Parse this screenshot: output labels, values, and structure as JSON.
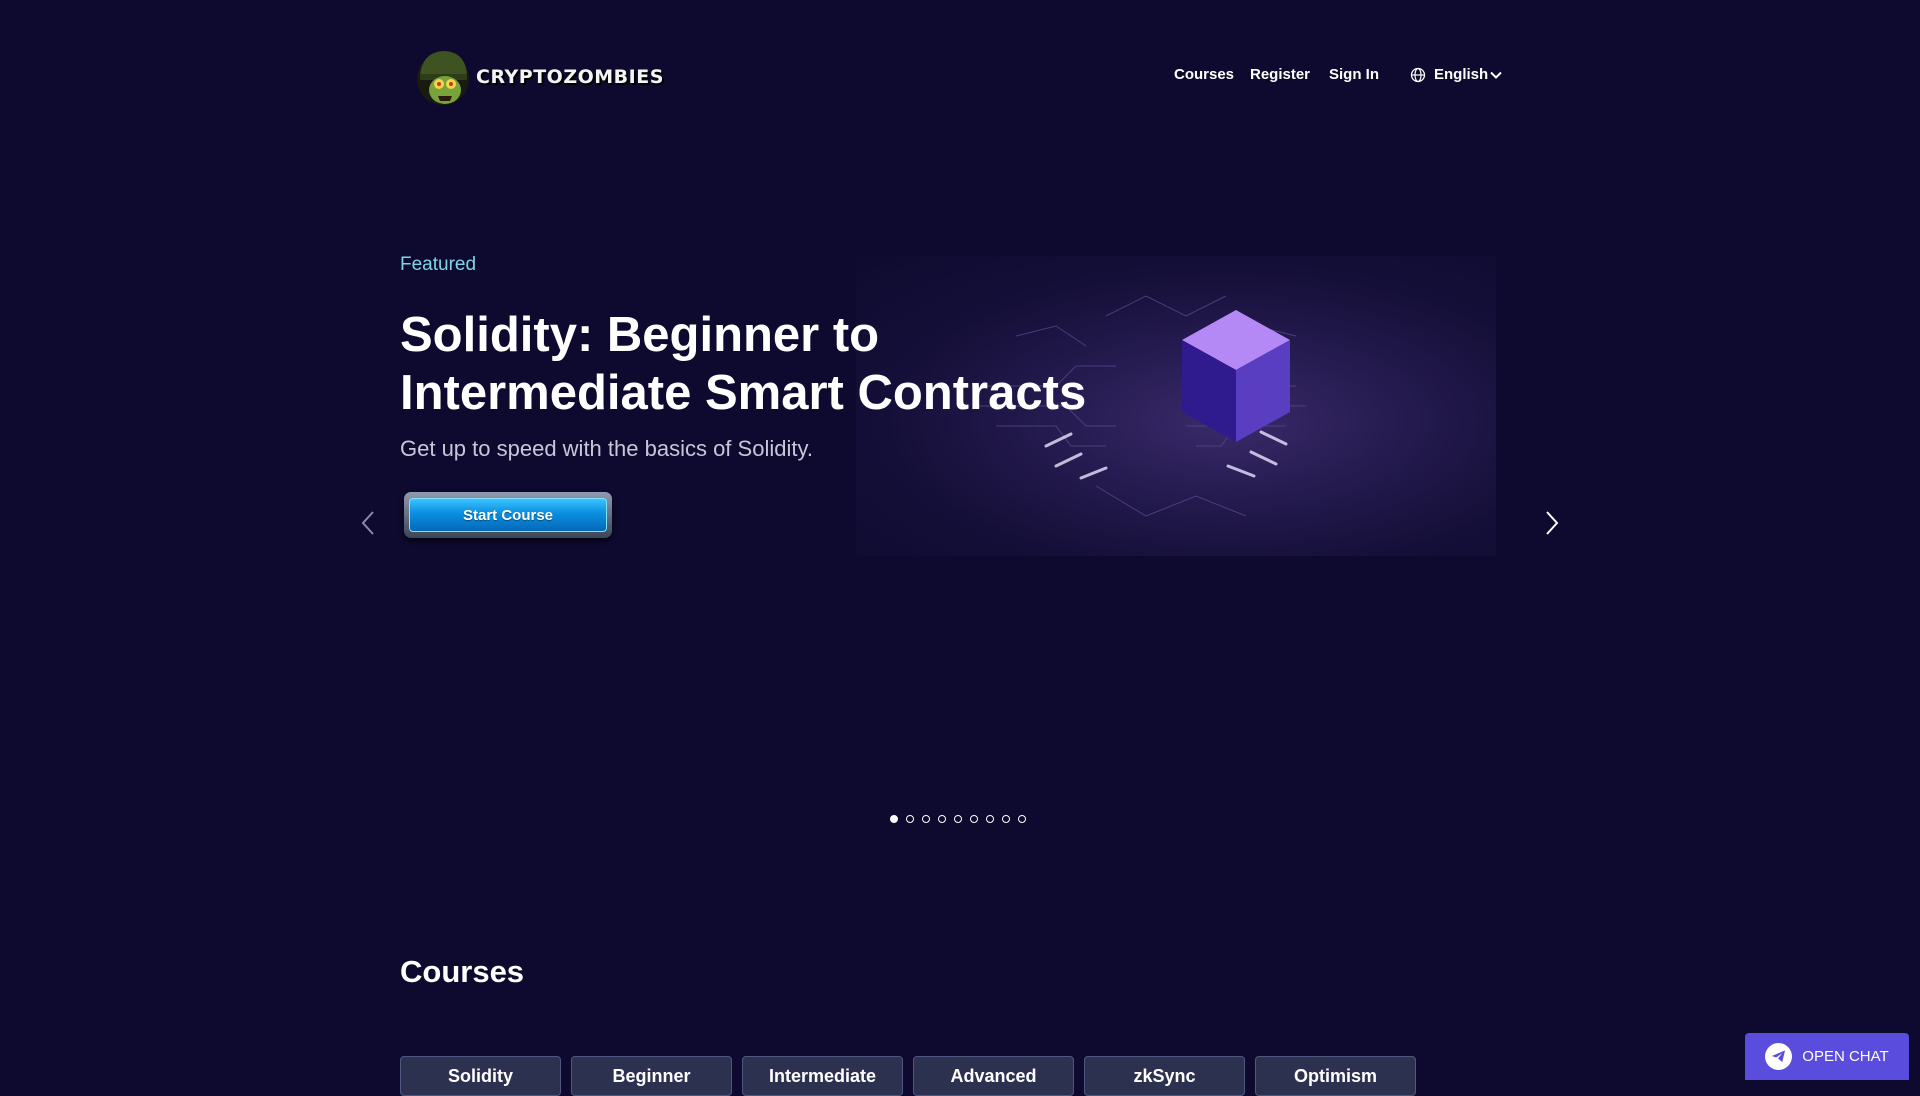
{
  "header": {
    "logo_text": "CryptoZombies",
    "nav": [
      {
        "label": "Courses"
      },
      {
        "label": "Register"
      },
      {
        "label": "Sign In"
      }
    ],
    "language": "English"
  },
  "hero": {
    "eyebrow": "Featured",
    "title": "Solidity: Beginner to Intermediate Smart Contracts",
    "subtitle": "Get up to speed with the basics of Solidity.",
    "cta_label": "Start Course",
    "slide_count": 9,
    "active_slide": 1
  },
  "courses": {
    "heading": "Courses",
    "filters": [
      {
        "label": "Solidity"
      },
      {
        "label": "Beginner"
      },
      {
        "label": "Intermediate"
      },
      {
        "label": "Advanced"
      },
      {
        "label": "zkSync"
      },
      {
        "label": "Optimism"
      }
    ]
  },
  "chat": {
    "label": "OPEN CHAT"
  },
  "colors": {
    "background": "#0e0a2f",
    "accent": "#7fd5e8",
    "cta": "#0a8ee0",
    "chat": "#5a4cdc"
  },
  "icons": [
    "globe-icon",
    "chevron-down-icon",
    "chevron-left-icon",
    "chevron-right-icon",
    "paper-plane-icon",
    "zombie-logo-icon",
    "cube-icon"
  ]
}
